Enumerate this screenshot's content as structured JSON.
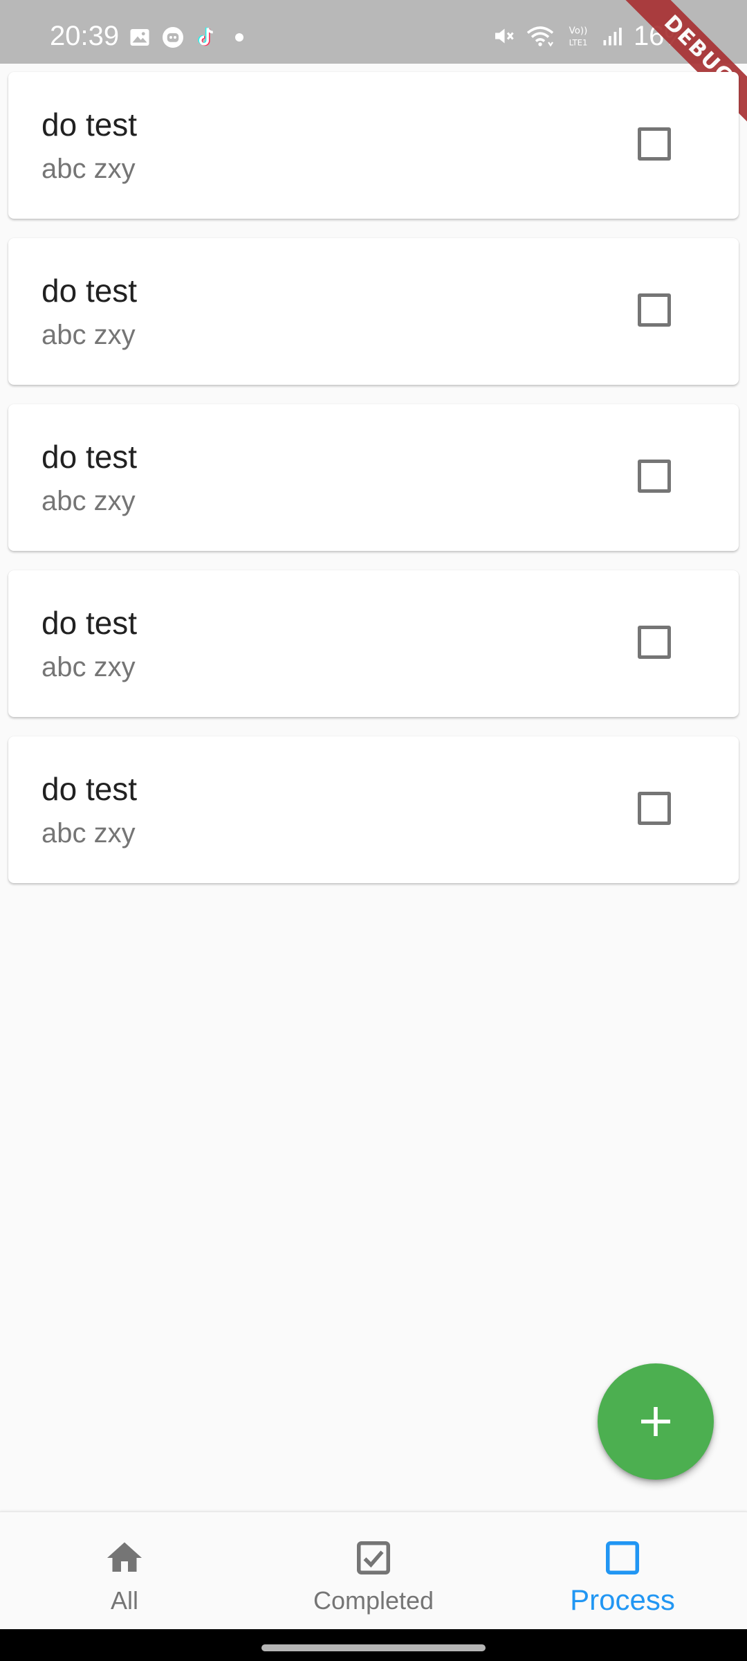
{
  "status_bar": {
    "time": "20:39",
    "battery": "16%",
    "left_icons": [
      "gallery-icon",
      "robot-icon",
      "tiktok-icon",
      "dot-icon"
    ],
    "right_icons": [
      "mute-icon",
      "wifi-icon",
      "volte-icon",
      "signal-icon"
    ]
  },
  "debug_banner": "DEBUG",
  "tasks": [
    {
      "title": "do test",
      "subtitle": "abc zxy",
      "checked": false
    },
    {
      "title": "do test",
      "subtitle": "abc zxy",
      "checked": false
    },
    {
      "title": "do test",
      "subtitle": "abc zxy",
      "checked": false
    },
    {
      "title": "do test",
      "subtitle": "abc zxy",
      "checked": false
    },
    {
      "title": "do test",
      "subtitle": "abc zxy",
      "checked": false
    }
  ],
  "fab": {
    "icon": "plus-icon",
    "color": "#4caf50"
  },
  "bottom_nav": {
    "items": [
      {
        "label": "All",
        "icon": "home-icon",
        "active": false
      },
      {
        "label": "Completed",
        "icon": "check-box-icon",
        "active": false
      },
      {
        "label": "Process",
        "icon": "check-box-outline-blank-icon",
        "active": true
      }
    ],
    "active_color": "#2196f3",
    "inactive_color": "#757575"
  }
}
